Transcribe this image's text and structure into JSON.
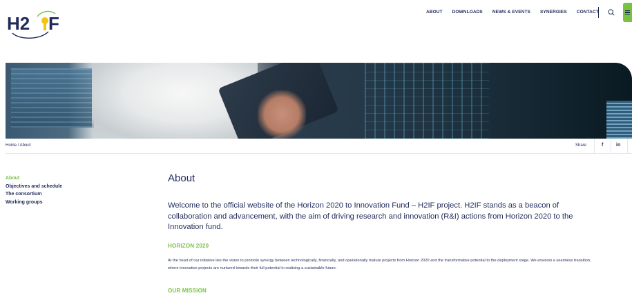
{
  "brand": {
    "logo_text": "H2IF",
    "accent_color": "#7ac143",
    "primary_color": "#1f2a5a"
  },
  "nav": {
    "items": [
      "ABOUT",
      "DOWNLOADS",
      "NEWS & EVENTS",
      "SYNERGIES",
      "CONTACT"
    ],
    "search_icon": "search-icon",
    "menu_icon": "hamburger-icon"
  },
  "breadcrumb": {
    "text": "Home / About"
  },
  "share": {
    "label": "Share",
    "facebook": "f",
    "linkedin": "in"
  },
  "sidebar": {
    "items": [
      {
        "label": "About",
        "active": true
      },
      {
        "label": "Objectives and schedule",
        "active": false
      },
      {
        "label": "The consortium",
        "active": false
      },
      {
        "label": "Working groups",
        "active": false
      }
    ]
  },
  "main": {
    "title": "About",
    "intro": "Welcome to the official website of the Horizon 2020 to Innovation Fund – H2IF project. H2IF stands as a beacon of collaboration and advancement, with the aim of driving research and innovation (R&I) actions from Horizon 2020 to the Innovation fund.",
    "section1_heading": "HORIZON 2020",
    "section1_text": "At the heart of our initiative lies the vision to promote synergy between technologically, financially, and operationally mature projects from Horizon 2020 and the transformative potential to the deployment stage. We envision a seamless transition, where innovative projects are nurtured towards their full potential in realising a sustainable future.",
    "section2_heading": "OUR MISSION"
  }
}
